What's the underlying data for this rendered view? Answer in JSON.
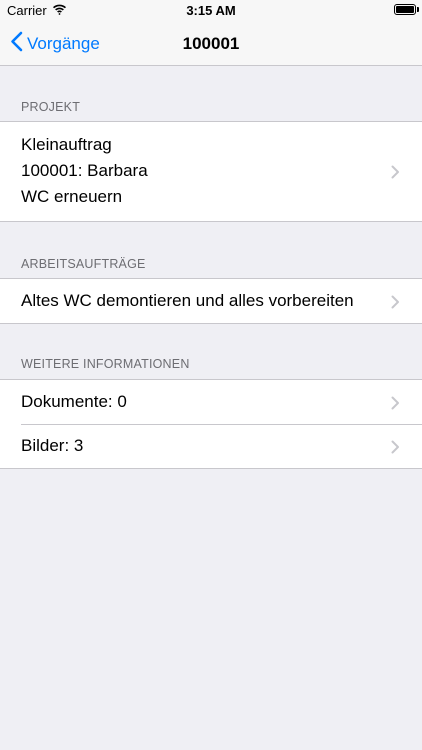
{
  "status_bar": {
    "carrier": "Carrier",
    "time": "3:15 AM"
  },
  "nav": {
    "back_label": "Vorgänge",
    "title": "100001"
  },
  "sections": {
    "projekt": {
      "header": "PROJEKT",
      "lines": [
        "Kleinauftrag",
        "100001: Barbara",
        "WC erneuern"
      ]
    },
    "arbeitsauftraege": {
      "header": "ARBEITSAUFTRÄGE",
      "items": [
        "Altes WC demontieren und alles vorbereiten"
      ]
    },
    "weitere": {
      "header": "WEITERE INFORMATIONEN",
      "items": [
        "Dokumente: 0",
        "Bilder: 3"
      ]
    }
  },
  "colors": {
    "accent": "#007aff",
    "background": "#efeff4",
    "separator": "#c8c7cc",
    "header_text": "#6d6d72",
    "chevron": "#c7c7cc"
  }
}
